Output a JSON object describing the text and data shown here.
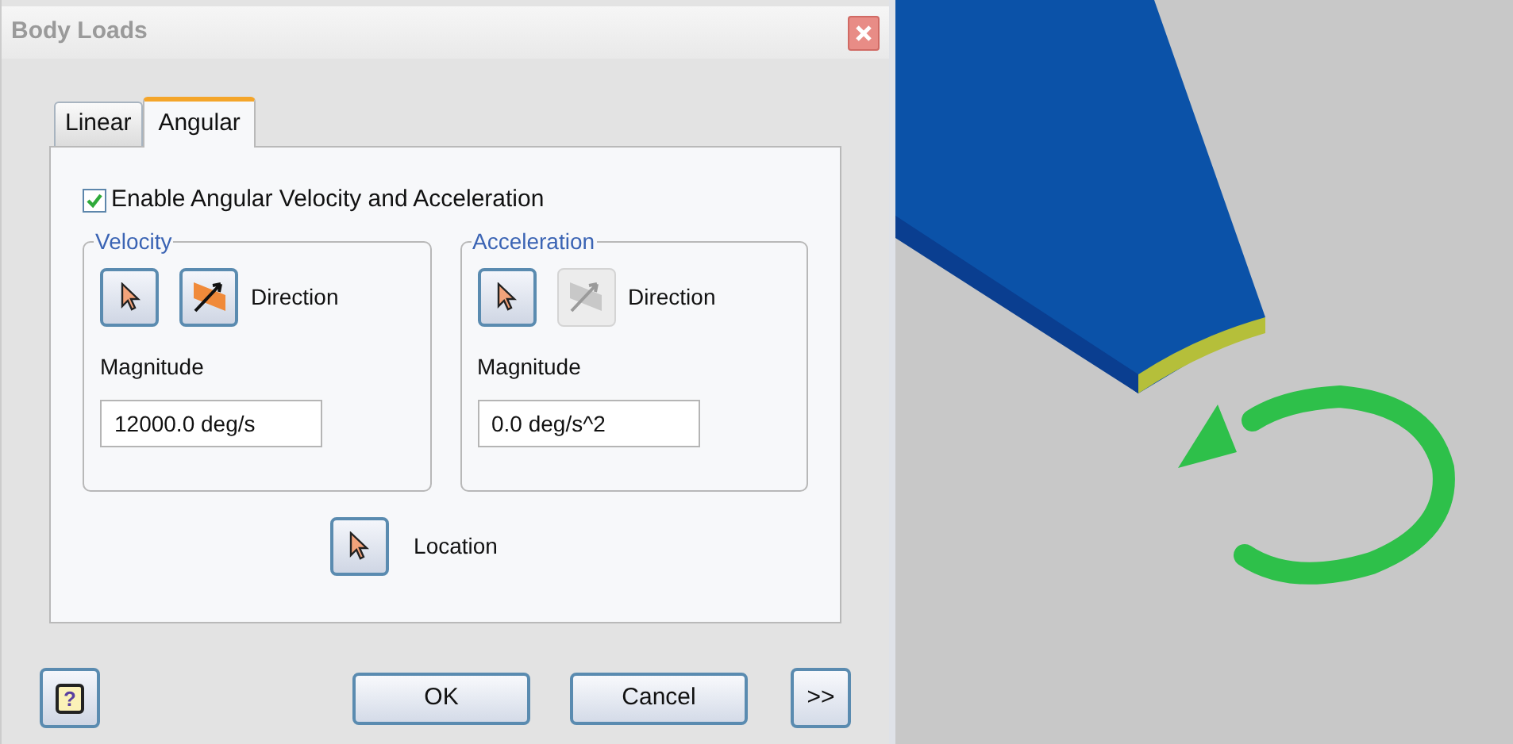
{
  "window": {
    "title": "Body Loads"
  },
  "tabs": [
    {
      "label": "Linear",
      "selected": false
    },
    {
      "label": "Angular",
      "selected": true
    }
  ],
  "enable": {
    "label": "Enable Angular Velocity and Acceleration",
    "checked": true
  },
  "groups": [
    {
      "title": "Velocity",
      "direction": {
        "label": "Direction",
        "disabled": false
      },
      "magnitude_label": "Magnitude",
      "value": "12000.0 deg/s"
    },
    {
      "title": "Acceleration",
      "direction": {
        "label": "Direction",
        "disabled": true
      },
      "magnitude_label": "Magnitude",
      "value": "0.0 deg/s^2"
    }
  ],
  "location": {
    "label": "Location"
  },
  "buttons": [
    {
      "kind": "help",
      "label": "?"
    },
    {
      "kind": "text",
      "label": "OK"
    },
    {
      "kind": "text",
      "label": "Cancel"
    },
    {
      "kind": "more",
      "label": ">>"
    }
  ]
}
